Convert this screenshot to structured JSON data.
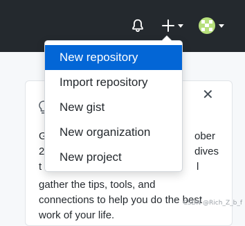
{
  "header": {
    "icons": {
      "notifications": "bell-icon",
      "create": "plus-icon",
      "avatar": "avatar-identicon"
    }
  },
  "dropdown": {
    "items": [
      {
        "label": "New repository",
        "active": true
      },
      {
        "label": "Import repository",
        "active": false
      },
      {
        "label": "New gist",
        "active": false
      },
      {
        "label": "New organization",
        "active": false
      },
      {
        "label": "New project",
        "active": false
      }
    ]
  },
  "card": {
    "close_icon": "close-icon",
    "fragments": {
      "r1_left": "G",
      "r1_right": "ober",
      "r2_left": "2",
      "r2_right": "dives",
      "r3_left": "t",
      "r3_right": "l"
    },
    "lines": [
      "gather the tips, tools, and",
      "connections to help you do the best",
      "work of your life."
    ]
  },
  "watermark": "CSDN @Rich_Z_b_f",
  "colors": {
    "topbar": "#24292e",
    "accent": "#0366d6",
    "page_bg": "#f6f8fa",
    "avatar": "#b7e07c"
  }
}
